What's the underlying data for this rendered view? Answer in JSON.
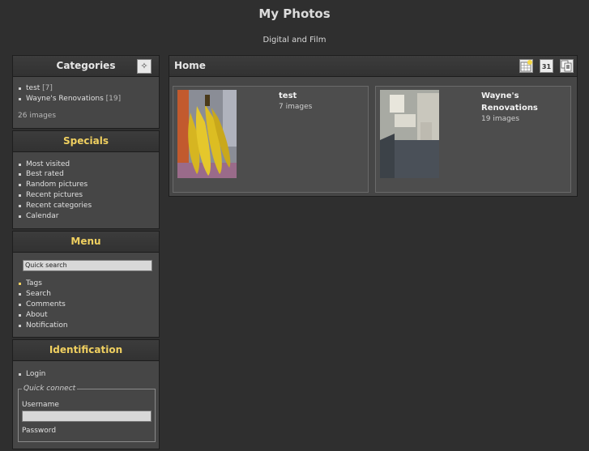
{
  "site": {
    "title": "My Photos",
    "subtitle": "Digital and Film"
  },
  "categories": {
    "title": "Categories",
    "items": [
      {
        "name": "test",
        "count": "[7]"
      },
      {
        "name": "Wayne's Renovations",
        "count": "[19]"
      }
    ],
    "total": "26 images"
  },
  "specials": {
    "title": "Specials",
    "items": [
      "Most visited",
      "Best rated",
      "Random pictures",
      "Recent pictures",
      "Recent categories",
      "Calendar"
    ]
  },
  "menu": {
    "title": "Menu",
    "quick_search": "Quick search",
    "items": [
      "Tags",
      "Search",
      "Comments",
      "About",
      "Notification"
    ]
  },
  "identification": {
    "title": "Identification",
    "login": "Login",
    "quick_connect": "Quick connect",
    "username_label": "Username",
    "password_label": "Password"
  },
  "main": {
    "breadcrumb": "Home",
    "tools": {
      "calendar_day": "31"
    },
    "albums": [
      {
        "title": "test",
        "count": "7 images"
      },
      {
        "title": "Wayne's Renovations",
        "count": "19 images"
      }
    ]
  }
}
